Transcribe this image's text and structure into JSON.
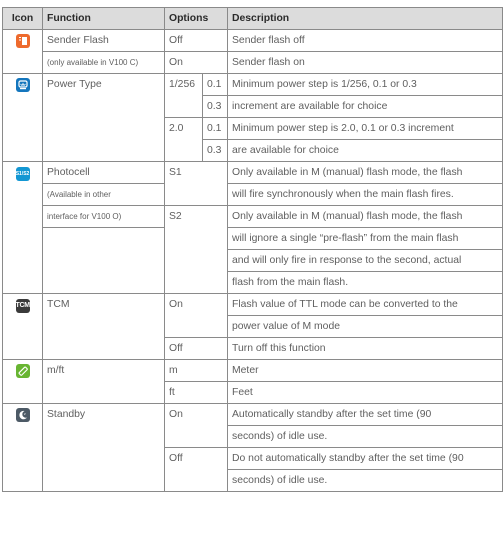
{
  "header": {
    "icon": "Icon",
    "function": "Function",
    "options": "Options",
    "description": "Description"
  },
  "sender_flash": {
    "icon": "sender-flash-icon",
    "function": "Sender Flash",
    "note": "(only available in V100 C)",
    "rows": [
      {
        "option": "Off",
        "desc": "Sender flash off"
      },
      {
        "option": "On",
        "desc": "Sender flash on"
      }
    ]
  },
  "power_type": {
    "icon": "power-type-icon",
    "function": "Power Type",
    "groups": [
      {
        "option": "1/256",
        "subs": [
          "0.1",
          "0.3"
        ],
        "lines": [
          "Minimum power step is 1/256, 0.1 or 0.3",
          "increment are available for choice"
        ]
      },
      {
        "option": "2.0",
        "subs": [
          "0.1",
          "0.3"
        ],
        "lines": [
          "Minimum power step is 2.0, 0.1 or 0.3 increment",
          "are available for choice"
        ]
      }
    ]
  },
  "photocell": {
    "icon": "photocell-icon",
    "icon_text": "S1/S2",
    "function": "Photocell",
    "note_lines": [
      "(Available in other",
      "interface for V100 O)"
    ],
    "rows": [
      {
        "option": "S1",
        "lines": [
          "Only available in M (manual) flash mode, the flash",
          "will fire synchronously when the main flash fires."
        ]
      },
      {
        "option": "S2",
        "lines": [
          "Only available in M (manual) flash mode, the flash",
          "will ignore a single “pre-flash” from the main flash",
          "and will only fire in response to the second, actual",
          "flash from the main flash."
        ]
      }
    ]
  },
  "tcm": {
    "icon": "tcm-icon",
    "icon_text": "TCM",
    "function": "TCM",
    "rows": [
      {
        "option": "On",
        "lines": [
          "Flash value of TTL mode can be converted to the",
          "power value of M mode"
        ]
      },
      {
        "option": "Off",
        "lines": [
          "Turn off this function"
        ]
      }
    ]
  },
  "mft": {
    "icon": "ruler-icon",
    "function": "m/ft",
    "rows": [
      {
        "option": "m",
        "lines": [
          "Meter"
        ]
      },
      {
        "option": "ft",
        "lines": [
          "Feet"
        ]
      }
    ]
  },
  "standby": {
    "icon": "standby-moon-icon",
    "function": "Standby",
    "rows": [
      {
        "option": "On",
        "lines": [
          "Automatically standby after the set time (90",
          "seconds) of idle use."
        ]
      },
      {
        "option": "Off",
        "lines": [
          "Do not automatically standby after the set time (90",
          "seconds) of idle use."
        ]
      }
    ]
  },
  "colors": {
    "orange": "#ee6a2d",
    "blue": "#1476bd",
    "cyan": "#1397d3",
    "dark": "#3a3a3a",
    "green": "#68b532",
    "gray": "#4d5a66",
    "header_bg": "#dcdcdc"
  }
}
